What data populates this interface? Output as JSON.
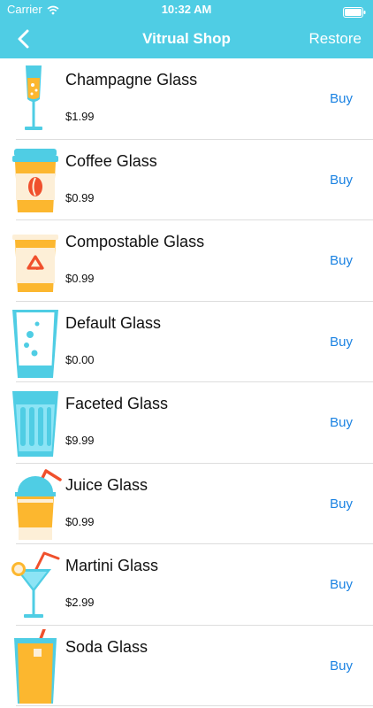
{
  "status_bar": {
    "carrier": "Carrier",
    "time": "10:32 AM"
  },
  "nav": {
    "title": "Vitrual Shop",
    "restore_label": "Restore"
  },
  "items": [
    {
      "name": "Champagne Glass",
      "price": "$1.99",
      "action": "Buy",
      "icon": "champagne-glass-icon"
    },
    {
      "name": "Coffee Glass",
      "price": "$0.99",
      "action": "Buy",
      "icon": "coffee-cup-icon"
    },
    {
      "name": "Compostable Glass",
      "price": "$0.99",
      "action": "Buy",
      "icon": "recycle-cup-icon"
    },
    {
      "name": "Default Glass",
      "price": "$0.00",
      "action": "Buy",
      "icon": "water-glass-icon"
    },
    {
      "name": "Faceted Glass",
      "price": "$9.99",
      "action": "Buy",
      "icon": "faceted-glass-icon"
    },
    {
      "name": "Juice Glass",
      "price": "$0.99",
      "action": "Buy",
      "icon": "juice-cup-icon"
    },
    {
      "name": "Martini Glass",
      "price": "$2.99",
      "action": "Buy",
      "icon": "martini-glass-icon"
    },
    {
      "name": "Soda Glass",
      "price": "",
      "action": "Buy",
      "icon": "soda-glass-icon"
    }
  ],
  "colors": {
    "accent": "#4fcde4",
    "link": "#1a82e2",
    "orange": "#fcb72f",
    "cream": "#fdefd7",
    "red": "#f0502c",
    "light_blue": "#8ce4f5"
  }
}
